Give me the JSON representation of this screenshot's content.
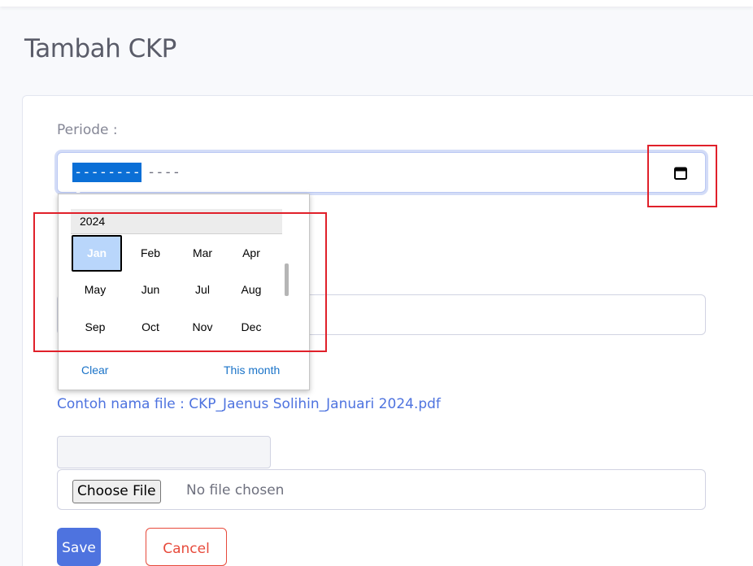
{
  "page": {
    "title": "Tambah CKP"
  },
  "form": {
    "periode_label": "Periode :",
    "periode_month_placeholder": "---------",
    "periode_year_placeholder": "----",
    "hint": "Contoh nama file : CKP_Jaenus Solihin_Januari 2024.pdf",
    "file_input": {
      "button_label": "Choose File",
      "status": "No file chosen"
    },
    "save_label": "Save",
    "cancel_label": "Cancel"
  },
  "picker": {
    "year": "2024",
    "selected_month": "Jan",
    "months": [
      "Jan",
      "Feb",
      "Mar",
      "Apr",
      "May",
      "Jun",
      "Jul",
      "Aug",
      "Sep",
      "Oct",
      "Nov",
      "Dec"
    ],
    "clear_label": "Clear",
    "this_month_label": "This month"
  },
  "colors": {
    "primary": "#4e73df",
    "danger": "#e74a3b",
    "annotation_red": "#e0202a",
    "selection_blue": "#0b6fd6"
  },
  "icons": {
    "calendar": "calendar-icon"
  }
}
